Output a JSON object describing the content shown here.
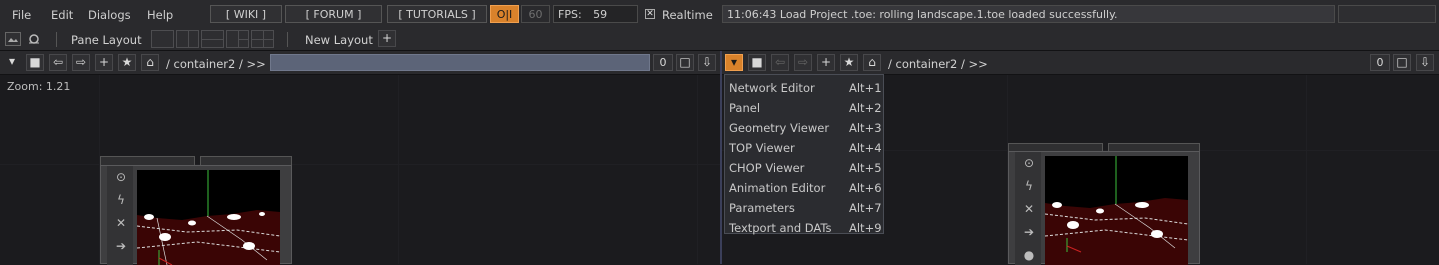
{
  "menubar": {
    "menus": [
      "File",
      "Edit",
      "Dialogs",
      "Help"
    ],
    "links": [
      "[ WIKI ]",
      "[ FORUM ]",
      "[ TUTORIALS ]"
    ],
    "oi_toggle": "O|I",
    "fps_cap": "60",
    "fps_label": "FPS:",
    "fps_value": "59",
    "realtime_label": "Realtime",
    "realtime_checked": true,
    "status_message": "11:06:43 Load Project .toe: rolling landscape.1.toe loaded successfully."
  },
  "pane_bar": {
    "pane_layout_label": "Pane Layout",
    "new_layout_label": "New Layout",
    "add_symbol": "+"
  },
  "left_pane": {
    "path": "/ container2 / >>",
    "counter": "0",
    "zoom_label": "Zoom: 1.21"
  },
  "right_pane": {
    "path": "/ container2 / >>",
    "counter": "0"
  },
  "pane_type_menu": {
    "items": [
      {
        "label": "Network Editor",
        "shortcut": "Alt+1"
      },
      {
        "label": "Panel",
        "shortcut": "Alt+2"
      },
      {
        "label": "Geometry Viewer",
        "shortcut": "Alt+3"
      },
      {
        "label": "TOP Viewer",
        "shortcut": "Alt+4"
      },
      {
        "label": "CHOP Viewer",
        "shortcut": "Alt+5"
      },
      {
        "label": "Animation Editor",
        "shortcut": "Alt+6"
      },
      {
        "label": "Parameters",
        "shortcut": "Alt+7"
      },
      {
        "label": "Textport and DATs",
        "shortcut": "Alt+9"
      }
    ]
  },
  "colors": {
    "accent": "#d9822b",
    "background": "#1b1b1e",
    "toolbar": "#2a2a2d",
    "path_field": "#5c6478",
    "viewport_ground": "#3a0505"
  },
  "icons": [
    "dropdown-arrow-icon",
    "stop-icon",
    "back-icon",
    "forward-icon",
    "add-icon",
    "star-icon",
    "home-icon",
    "split-icon",
    "download-icon",
    "viewer-icon",
    "bypass-icon",
    "close-icon",
    "arrow-icon",
    "lock-icon"
  ]
}
